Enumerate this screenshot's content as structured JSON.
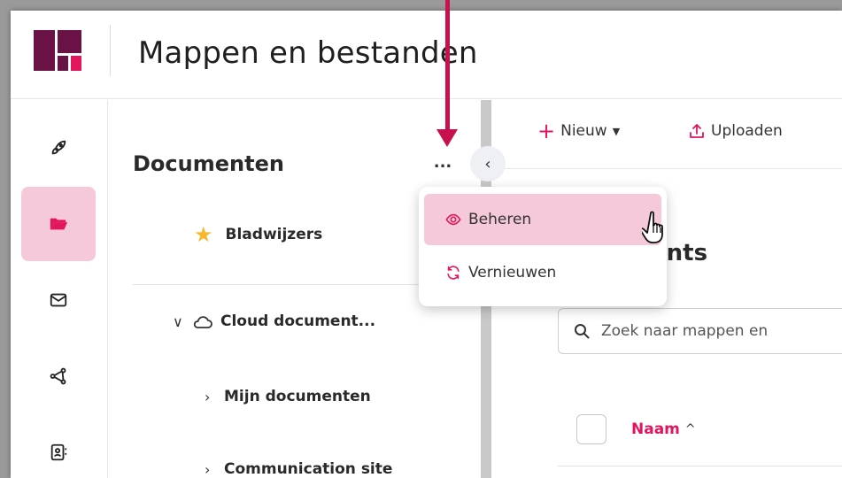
{
  "header": {
    "title": "Mappen en bestanden"
  },
  "rail": {
    "items": [
      {
        "icon": "rocket-icon",
        "active": false
      },
      {
        "icon": "folder-open-icon",
        "active": true
      },
      {
        "icon": "mail-icon",
        "active": false
      },
      {
        "icon": "share-icon",
        "active": false
      },
      {
        "icon": "contact-card-icon",
        "active": false
      }
    ]
  },
  "panel": {
    "title": "Documenten",
    "more_label": "...",
    "collapse_label": "‹",
    "bookmarks_label": "Bladwijzers",
    "tree": [
      {
        "label": "Cloud document...",
        "expanded": true,
        "icon": "cloud-icon"
      },
      {
        "label": "Mijn documenten",
        "expanded": false
      },
      {
        "label": "Communication site",
        "expanded": false
      }
    ]
  },
  "toolbar": {
    "new_label": "Nieuw",
    "upload_label": "Uploaden"
  },
  "main": {
    "heading": "ents",
    "search_placeholder": "Zoek naar mappen en",
    "column_name": "Naam"
  },
  "menu": {
    "items": [
      {
        "label": "Beheren",
        "icon": "eye-icon",
        "hover": true
      },
      {
        "label": "Vernieuwen",
        "icon": "refresh-icon",
        "hover": false
      }
    ]
  },
  "colors": {
    "accent": "#e2165e",
    "brand_dark": "#6a1245",
    "hover_bg": "#f5c9d9",
    "annotation_arrow": "#c8104f"
  }
}
